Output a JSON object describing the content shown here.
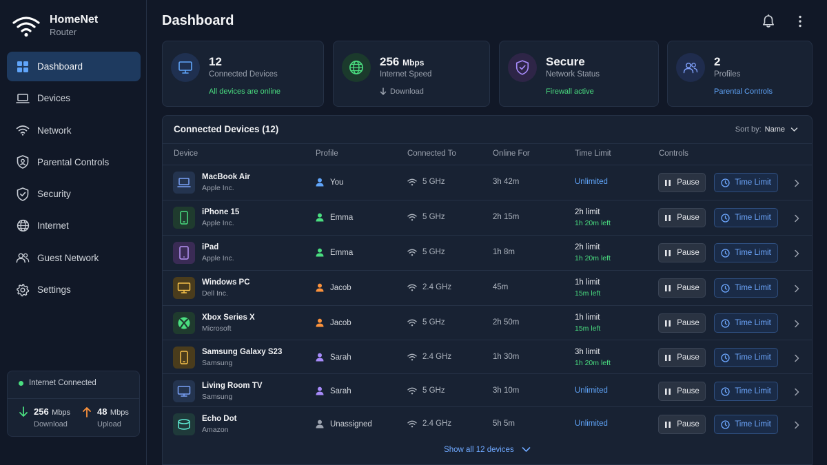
{
  "app": {
    "name": "HomeNet",
    "subtitle": "Router"
  },
  "sidebar": {
    "items": [
      {
        "label": "Dashboard",
        "icon": "grid-icon",
        "active": true
      },
      {
        "label": "Devices",
        "icon": "laptop-icon"
      },
      {
        "label": "Network",
        "icon": "wifi-icon"
      },
      {
        "label": "Parental Controls",
        "icon": "shield-user-icon"
      },
      {
        "label": "Security",
        "icon": "shield-check-icon"
      },
      {
        "label": "Internet",
        "icon": "globe-icon"
      },
      {
        "label": "Guest Network",
        "icon": "users-icon"
      },
      {
        "label": "Settings",
        "icon": "gear-icon"
      }
    ],
    "status": {
      "label": "Internet Connected",
      "download_value": "256",
      "download_unit": "Mbps",
      "download_label": "Download",
      "upload_value": "48",
      "upload_unit": "Mbps",
      "upload_label": "Upload"
    }
  },
  "header": {
    "title": "Dashboard"
  },
  "stats": [
    {
      "value": "12",
      "unit": "",
      "label": "Connected Devices",
      "sub": "All devices are online",
      "sub_color": "#4ade80",
      "icon": "monitor-icon"
    },
    {
      "value": "256",
      "unit": "Mbps",
      "label": "Internet Speed",
      "sub": "Download",
      "sub_color": "#9ca3af",
      "icon": "globe-icon"
    },
    {
      "value": "Secure",
      "unit": "",
      "label": "Network Status",
      "sub": "Firewall active",
      "sub_color": "#4ade80",
      "icon": "shield-check-icon"
    },
    {
      "value": "2",
      "unit": "",
      "label": "Profiles",
      "sub": "Parental Controls",
      "sub_color": "#60a5fa",
      "icon": "users-icon"
    }
  ],
  "devices_table": {
    "title": "Connected Devices (12)",
    "sort_label": "Sort by:",
    "sort_value": "Name",
    "columns": [
      "Device",
      "Profile",
      "Connected To",
      "Online For",
      "Time Limit",
      "Controls"
    ],
    "pause_label": "Pause",
    "time_limit_label": "Time Limit",
    "show_all": "Show all 12 devices",
    "rows": [
      {
        "name": "MacBook Air",
        "maker": "Apple Inc.",
        "profile": "You",
        "connected": "5 GHz",
        "online": "3h 42m",
        "limit": "Unlimited",
        "left": "",
        "icon": "laptop-icon"
      },
      {
        "name": "iPhone 15",
        "maker": "Apple Inc.",
        "profile": "Emma",
        "connected": "5 GHz",
        "online": "2h 15m",
        "limit": "2h limit",
        "left": "1h 20m left",
        "icon": "phone-icon"
      },
      {
        "name": "iPad",
        "maker": "Apple Inc.",
        "profile": "Emma",
        "connected": "5 GHz",
        "online": "1h 8m",
        "limit": "2h limit",
        "left": "1h 20m left",
        "icon": "tablet-icon"
      },
      {
        "name": "Windows PC",
        "maker": "Dell Inc.",
        "profile": "Jacob",
        "connected": "2.4 GHz",
        "online": "45m",
        "limit": "1h limit",
        "left": "15m left",
        "icon": "desktop-icon"
      },
      {
        "name": "Xbox Series X",
        "maker": "Microsoft",
        "profile": "Jacob",
        "connected": "5 GHz",
        "online": "2h 50m",
        "limit": "1h limit",
        "left": "15m left",
        "icon": "xbox-icon"
      },
      {
        "name": "Samsung Galaxy S23",
        "maker": "Samsung",
        "profile": "Sarah",
        "connected": "2.4 GHz",
        "online": "1h 30m",
        "limit": "3h limit",
        "left": "1h 20m left",
        "icon": "phone-icon"
      },
      {
        "name": "Living Room TV",
        "maker": "Samsung",
        "profile": "Sarah",
        "connected": "5 GHz",
        "online": "3h 10m",
        "limit": "Unlimited",
        "left": "",
        "icon": "tv-icon"
      },
      {
        "name": "Echo Dot",
        "maker": "Amazon",
        "profile": "Unassigned",
        "connected": "2.4 GHz",
        "online": "5h 5m",
        "limit": "Unlimited",
        "left": "",
        "icon": "speaker-icon"
      }
    ]
  },
  "colors": {
    "accent": "#60a5fa",
    "success": "#4ade80",
    "profile_you": "#60a5fa",
    "profile_emma": "#4ade80",
    "profile_jacob": "#fb923c",
    "profile_sarah": "#a78bfa",
    "profile_unassigned": "#9ca3af"
  }
}
